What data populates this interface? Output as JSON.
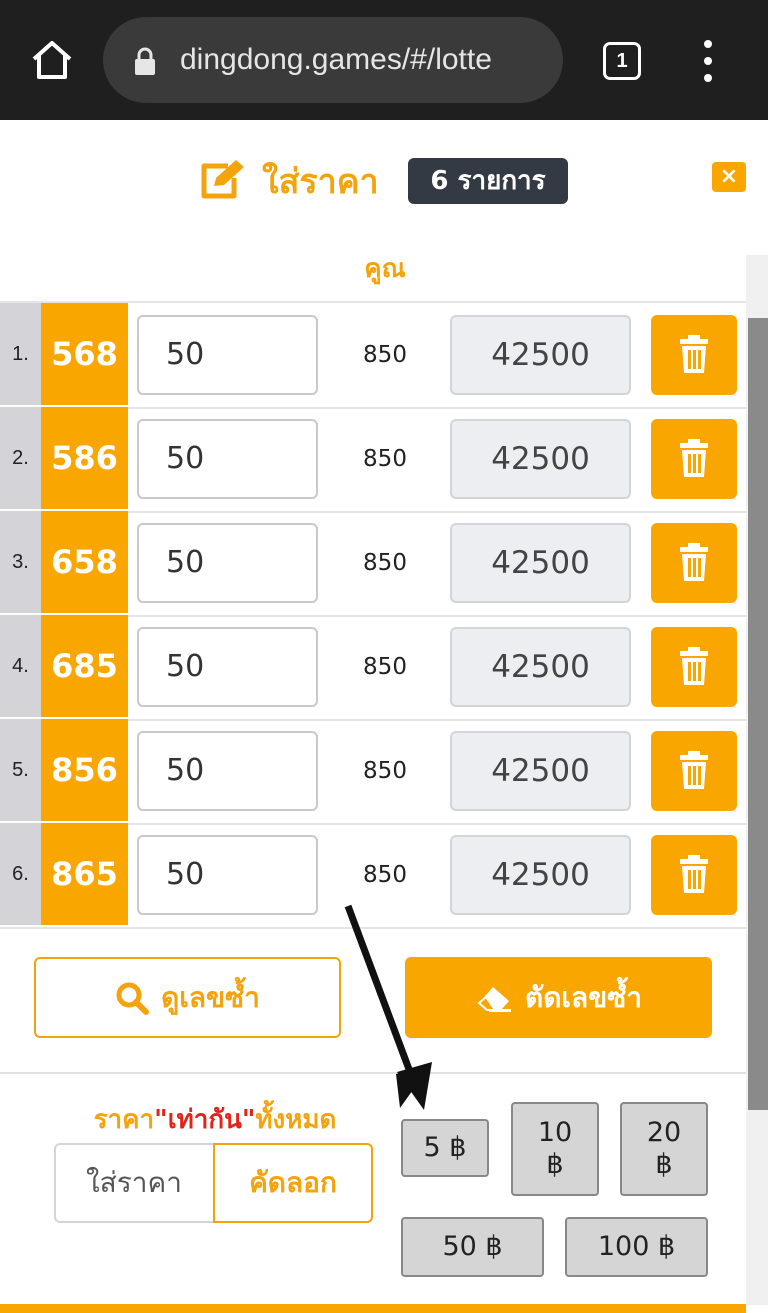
{
  "browser": {
    "url": "dingdong.games/#/lotte",
    "tab_count": "1",
    "icons": [
      "home-icon",
      "lock-icon",
      "more-vert-icon"
    ]
  },
  "header": {
    "title": "ใส่ราคา",
    "count_badge": "6 รายการ",
    "close_label": "×",
    "icons": [
      "edit-icon",
      "close-icon"
    ]
  },
  "table": {
    "column_header": "คูณ",
    "rows": [
      {
        "index": "1.",
        "number": "568",
        "amount": "50",
        "rate": "850",
        "win": "42500"
      },
      {
        "index": "2.",
        "number": "586",
        "amount": "50",
        "rate": "850",
        "win": "42500"
      },
      {
        "index": "3.",
        "number": "658",
        "amount": "50",
        "rate": "850",
        "win": "42500"
      },
      {
        "index": "4.",
        "number": "685",
        "amount": "50",
        "rate": "850",
        "win": "42500"
      },
      {
        "index": "5.",
        "number": "856",
        "amount": "50",
        "rate": "850",
        "win": "42500"
      },
      {
        "index": "6.",
        "number": "865",
        "amount": "50",
        "rate": "850",
        "win": "42500"
      }
    ]
  },
  "actions": {
    "view_duplicates": "ดูเลขซ้ำ",
    "cut_duplicates": "ตัดเลขซ้ำ"
  },
  "same_price": {
    "label_prefix": "ราคา",
    "label_quoted": "\"เท่ากัน\"",
    "label_suffix": "ทั้งหมด",
    "input_label": "ใส่ราคา",
    "copy_label": "คัดลอก"
  },
  "chips": [
    "5 ฿",
    "10 ฿",
    "20 ฿",
    "50 ฿",
    "100 ฿"
  ],
  "colors": {
    "accent": "#f9a600",
    "badge": "#333a44",
    "chrome": "#1f1f1f"
  }
}
